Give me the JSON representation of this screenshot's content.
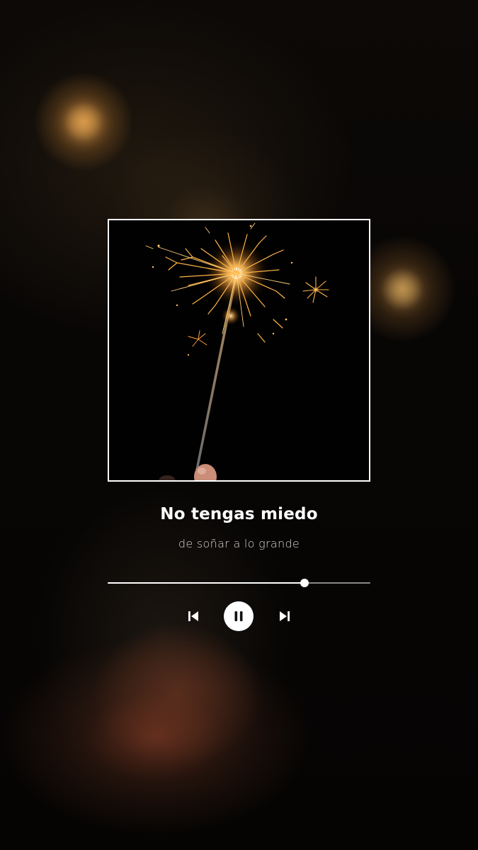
{
  "track": {
    "title": "No tengas miedo",
    "subtitle": "de soñar a lo grande"
  },
  "player": {
    "progress": 0.75,
    "state": "playing",
    "controls": {
      "previous_icon": "skip-previous-icon",
      "play_pause_icon": "pause-icon",
      "next_icon": "skip-next-icon"
    }
  },
  "colors": {
    "text_primary": "#ffffff",
    "text_secondary": "#d6d6d6",
    "progress_fill": "#ffffff",
    "progress_track": "#8a8a8a",
    "background": "#000000"
  }
}
